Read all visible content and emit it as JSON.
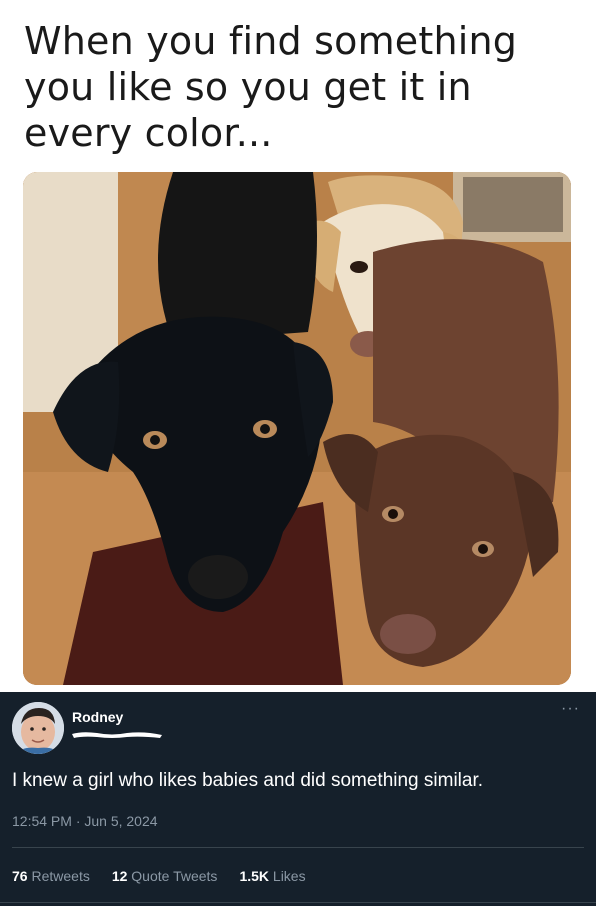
{
  "meme": {
    "caption": "When you find something you like so you get it in every color...",
    "photo_alt": "Three Labrador dogs: black, yellow and chocolate"
  },
  "tweet": {
    "author_name": "Rodney",
    "handle": "",
    "text": "I knew a girl who likes babies and did something similar.",
    "timestamp": "12:54 PM · Jun 5, 2024",
    "more_icon": "more-dots-icon",
    "stats": [
      {
        "count": "76",
        "label": "Retweets"
      },
      {
        "count": "12",
        "label": "Quote Tweets"
      },
      {
        "count": "1.5K",
        "label": "Likes"
      }
    ]
  },
  "colors": {
    "tweet_background": "#15202b",
    "secondary_text": "#8b98a5",
    "divider": "#38444d"
  }
}
